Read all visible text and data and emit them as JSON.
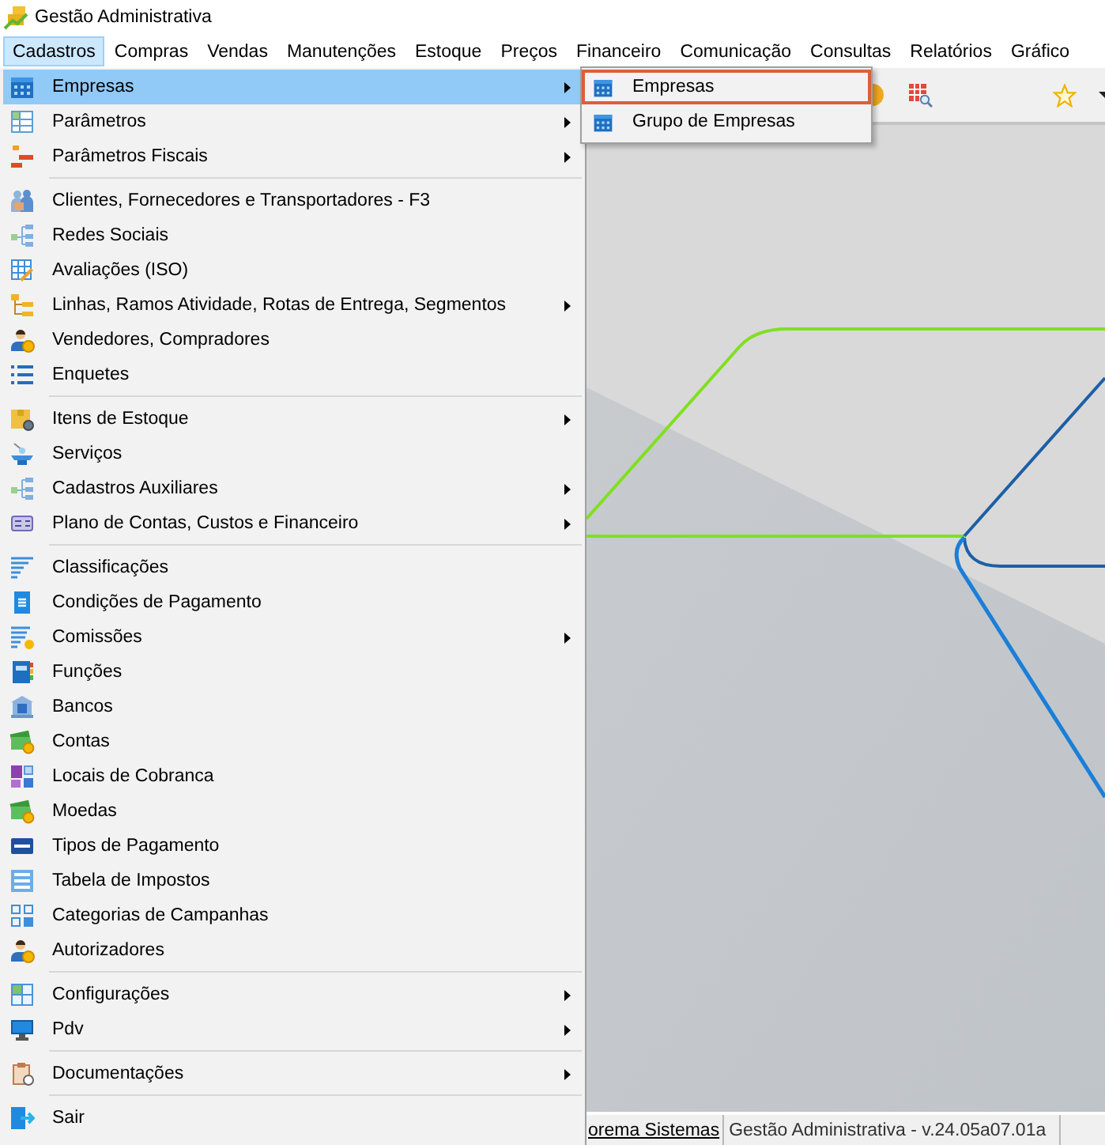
{
  "window": {
    "title": "Gestão Administrativa"
  },
  "menu_bar": {
    "items": [
      {
        "label": "Cadastros",
        "selected": true
      },
      {
        "label": "Compras",
        "selected": false
      },
      {
        "label": "Vendas",
        "selected": false
      },
      {
        "label": "Manutenções",
        "selected": false
      },
      {
        "label": "Estoque",
        "selected": false
      },
      {
        "label": "Preços",
        "selected": false
      },
      {
        "label": "Financeiro",
        "selected": false
      },
      {
        "label": "Comunicação",
        "selected": false
      },
      {
        "label": "Consultas",
        "selected": false
      },
      {
        "label": "Relatórios",
        "selected": false
      },
      {
        "label": "Gráfico",
        "selected": false
      }
    ]
  },
  "dropdown": {
    "groups": [
      {
        "items": [
          {
            "label": "Empresas",
            "selected": true,
            "submenu": true
          },
          {
            "label": "Parâmetros",
            "selected": false,
            "submenu": true
          },
          {
            "label": "Parâmetros Fiscais",
            "selected": false,
            "submenu": true
          }
        ]
      },
      {
        "items": [
          {
            "label": "Clientes, Fornecedores e Transportadores - F3",
            "selected": false,
            "submenu": false
          },
          {
            "label": "Redes Sociais",
            "selected": false,
            "submenu": false
          },
          {
            "label": "Avaliações (ISO)",
            "selected": false,
            "submenu": false
          },
          {
            "label": "Linhas, Ramos Atividade, Rotas de Entrega, Segmentos",
            "selected": false,
            "submenu": true
          },
          {
            "label": "Vendedores, Compradores",
            "selected": false,
            "submenu": false
          },
          {
            "label": "Enquetes",
            "selected": false,
            "submenu": false
          }
        ]
      },
      {
        "items": [
          {
            "label": "Itens de Estoque",
            "selected": false,
            "submenu": true
          },
          {
            "label": "Serviços",
            "selected": false,
            "submenu": false
          },
          {
            "label": "Cadastros Auxiliares",
            "selected": false,
            "submenu": true
          },
          {
            "label": "Plano de Contas, Custos e Financeiro",
            "selected": false,
            "submenu": true
          }
        ]
      },
      {
        "items": [
          {
            "label": "Classificações",
            "selected": false,
            "submenu": false
          },
          {
            "label": "Condições de Pagamento",
            "selected": false,
            "submenu": false
          },
          {
            "label": "Comissões",
            "selected": false,
            "submenu": true
          },
          {
            "label": "Funções",
            "selected": false,
            "submenu": false
          },
          {
            "label": "Bancos",
            "selected": false,
            "submenu": false
          },
          {
            "label": "Contas",
            "selected": false,
            "submenu": false
          },
          {
            "label": "Locais de Cobranca",
            "selected": false,
            "submenu": false
          },
          {
            "label": "Moedas",
            "selected": false,
            "submenu": false
          },
          {
            "label": "Tipos de Pagamento",
            "selected": false,
            "submenu": false
          },
          {
            "label": "Tabela de Impostos",
            "selected": false,
            "submenu": false
          },
          {
            "label": "Categorias de Campanhas",
            "selected": false,
            "submenu": false
          },
          {
            "label": "Autorizadores",
            "selected": false,
            "submenu": false
          }
        ]
      },
      {
        "items": [
          {
            "label": "Configurações",
            "selected": false,
            "submenu": true
          },
          {
            "label": "Pdv",
            "selected": false,
            "submenu": true
          }
        ]
      },
      {
        "items": [
          {
            "label": "Documentações",
            "selected": false,
            "submenu": true
          }
        ]
      },
      {
        "items": [
          {
            "label": "Sair",
            "selected": false,
            "submenu": false
          }
        ]
      }
    ]
  },
  "submenu": {
    "items": [
      {
        "label": "Empresas",
        "selected": true
      },
      {
        "label": "Grupo de Empresas",
        "selected": false
      }
    ]
  },
  "status_bar": {
    "items": [
      {
        "kind": "link",
        "text": "orema Sistemas"
      },
      {
        "kind": "text",
        "text": "Gestão Administrativa - v.24.05a07.01a"
      }
    ]
  }
}
